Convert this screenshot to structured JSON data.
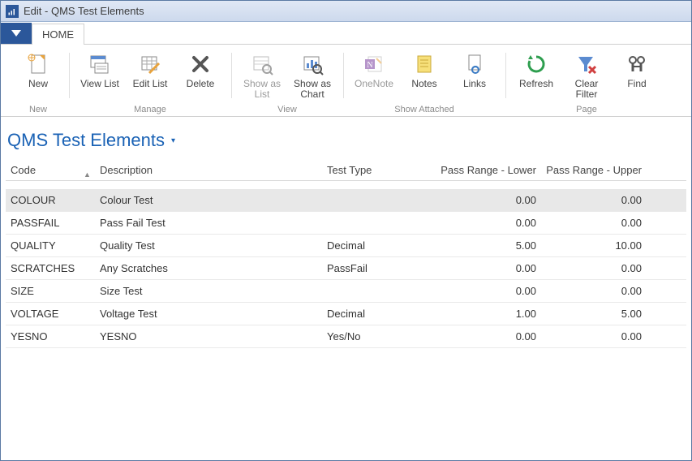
{
  "window": {
    "title": "Edit - QMS Test Elements"
  },
  "tabs": {
    "home": "HOME"
  },
  "ribbon": {
    "groups": [
      {
        "label": "New",
        "buttons": [
          {
            "id": "new",
            "label": "New"
          }
        ]
      },
      {
        "label": "Manage",
        "buttons": [
          {
            "id": "view-list",
            "label": "View List"
          },
          {
            "id": "edit-list",
            "label": "Edit List"
          },
          {
            "id": "delete",
            "label": "Delete"
          }
        ]
      },
      {
        "label": "View",
        "buttons": [
          {
            "id": "show-as-list",
            "label": "Show as List",
            "disabled": true
          },
          {
            "id": "show-as-chart",
            "label": "Show as Chart"
          }
        ]
      },
      {
        "label": "Show Attached",
        "buttons": [
          {
            "id": "onenote",
            "label": "OneNote",
            "disabled": true
          },
          {
            "id": "notes",
            "label": "Notes"
          },
          {
            "id": "links",
            "label": "Links"
          }
        ]
      },
      {
        "label": "Page",
        "buttons": [
          {
            "id": "refresh",
            "label": "Refresh"
          },
          {
            "id": "clear-filter",
            "label": "Clear Filter"
          },
          {
            "id": "find",
            "label": "Find"
          }
        ]
      }
    ]
  },
  "page": {
    "title": "QMS Test Elements"
  },
  "grid": {
    "columns": {
      "code": "Code",
      "description": "Description",
      "test_type": "Test Type",
      "pass_lower": "Pass Range - Lower",
      "pass_upper": "Pass Range - Upper"
    },
    "rows": [
      {
        "code": "COLOUR",
        "description": "Colour Test",
        "test_type": "",
        "lower": "0.00",
        "upper": "0.00",
        "selected": true
      },
      {
        "code": "PASSFAIL",
        "description": "Pass Fail Test",
        "test_type": "",
        "lower": "0.00",
        "upper": "0.00"
      },
      {
        "code": "QUALITY",
        "description": "Quality Test",
        "test_type": "Decimal",
        "lower": "5.00",
        "upper": "10.00"
      },
      {
        "code": "SCRATCHES",
        "description": "Any Scratches",
        "test_type": "PassFail",
        "lower": "0.00",
        "upper": "0.00"
      },
      {
        "code": "SIZE",
        "description": "Size Test",
        "test_type": "",
        "lower": "0.00",
        "upper": "0.00"
      },
      {
        "code": "VOLTAGE",
        "description": "Voltage Test",
        "test_type": "Decimal",
        "lower": "1.00",
        "upper": "5.00"
      },
      {
        "code": "YESNO",
        "description": "YESNO",
        "test_type": "Yes/No",
        "lower": "0.00",
        "upper": "0.00"
      }
    ]
  }
}
